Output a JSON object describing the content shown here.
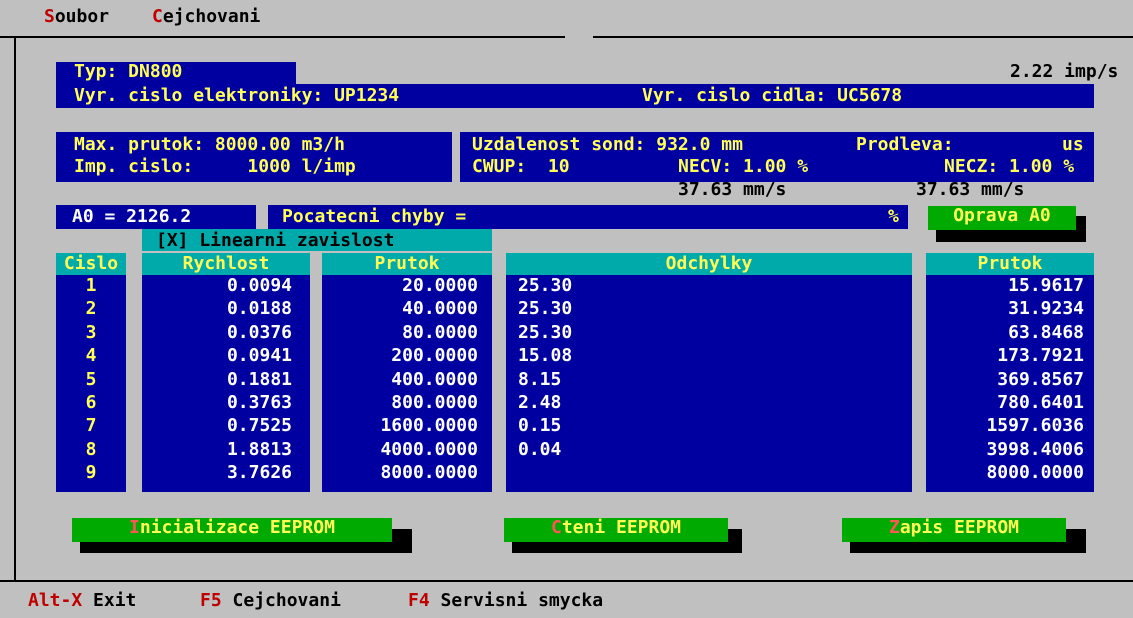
{
  "menu": {
    "soubor_hot": "S",
    "soubor_rest": "oubor",
    "cejch_hot": "C",
    "cejch_rest": "ejchovani"
  },
  "header": {
    "typ": "Typ: DN800",
    "imp_rate": "2.22 imp/s",
    "vyr_elektroniky": "Vyr. cislo elektroniky: UP1234",
    "vyr_cidla": "Vyr. cislo cidla: UC5678"
  },
  "params": {
    "max_prutok": "Max. prutok: 8000.00 m3/h",
    "imp_cislo": "Imp. cislo:     1000 l/imp",
    "uzdalenost": "Uzdalenost sond: 932.0 mm",
    "prodleva": "Prodleva:",
    "prodleva_unit": "us",
    "cwvp": "CWUP:  10",
    "necv": "NECV: 1.00 %",
    "necz": "NECZ: 1.00 %",
    "speed1": "37.63 mm/s",
    "speed2": "37.63 mm/s"
  },
  "a0": {
    "value": "A0 = 2126.2",
    "pocatecni": "Pocatecni chyby =",
    "pct": "%",
    "oprava_label": "Oprava A0",
    "linearni": "[X] Linearni zavislost"
  },
  "table": {
    "headers": {
      "cislo": "Cislo",
      "rychlost": "Rychlost",
      "prutok": "Prutok",
      "odchylky": "Odchylky",
      "prutok2": "Prutok"
    },
    "rows": [
      {
        "n": "1",
        "r": "0.0094",
        "p": "20.0000",
        "o": "25.30",
        "p2": "15.9617"
      },
      {
        "n": "2",
        "r": "0.0188",
        "p": "40.0000",
        "o": "25.30",
        "p2": "31.9234"
      },
      {
        "n": "3",
        "r": "0.0376",
        "p": "80.0000",
        "o": "25.30",
        "p2": "63.8468"
      },
      {
        "n": "4",
        "r": "0.0941",
        "p": "200.0000",
        "o": "15.08",
        "p2": "173.7921"
      },
      {
        "n": "5",
        "r": "0.1881",
        "p": "400.0000",
        "o": "8.15",
        "p2": "369.8567"
      },
      {
        "n": "6",
        "r": "0.3763",
        "p": "800.0000",
        "o": "2.48",
        "p2": "780.6401"
      },
      {
        "n": "7",
        "r": "0.7525",
        "p": "1600.0000",
        "o": "0.15",
        "p2": "1597.6036"
      },
      {
        "n": "8",
        "r": "1.8813",
        "p": "4000.0000",
        "o": "0.04",
        "p2": "3998.4006"
      },
      {
        "n": "9",
        "r": "3.7626",
        "p": "8000.0000",
        "o": "",
        "p2": "8000.0000"
      }
    ]
  },
  "buttons": {
    "init_hot": "I",
    "init_rest": "nicializace EEPROM",
    "cteni_hot": "C",
    "cteni_rest": "teni EEPROM",
    "zapis_hot": "Z",
    "zapis_rest": "apis EEPROM"
  },
  "status": {
    "k1": "Alt-X",
    "l1": "Exit",
    "k2": "F5",
    "l2": "Cejchovani",
    "k3": "F4",
    "l3": "Servisni smycka"
  }
}
